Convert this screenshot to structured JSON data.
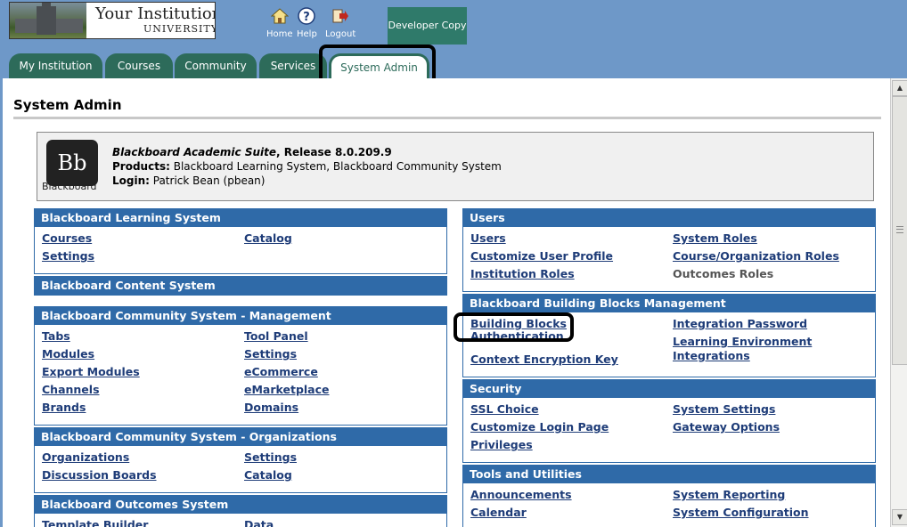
{
  "header": {
    "logo_title": "Your Institution",
    "logo_subtitle": "UNIVERSITY",
    "nav": {
      "home": "Home",
      "help": "Help",
      "logout": "Logout"
    },
    "developer_copy": "Developer Copy"
  },
  "tabs": [
    {
      "label": "My Institution"
    },
    {
      "label": "Courses"
    },
    {
      "label": "Community"
    },
    {
      "label": "Services"
    },
    {
      "label": "System Admin"
    }
  ],
  "page": {
    "title": "System Admin"
  },
  "info": {
    "logo_text": "Bb",
    "logo_label": "Blackboard",
    "suite_name": "Blackboard Academic Suite",
    "release": ", Release 8.0.209.9",
    "products_label": "Products:",
    "products_value": " Blackboard Learning System, Blackboard Community System",
    "login_label": "Login:",
    "login_value": " Patrick Bean (pbean)"
  },
  "panels": {
    "bls": {
      "title": "Blackboard Learning System",
      "links": [
        "Courses",
        "Catalog",
        "Settings"
      ]
    },
    "bcs": {
      "title": "Blackboard Content System"
    },
    "bcm": {
      "title": "Blackboard Community System - Management",
      "links": [
        "Tabs",
        "Tool Panel",
        "Modules",
        "Settings",
        "Export Modules",
        "eCommerce",
        "Channels",
        "eMarketplace",
        "Brands",
        "Domains"
      ]
    },
    "bco": {
      "title": "Blackboard Community System - Organizations",
      "links": [
        "Organizations",
        "Settings",
        "Discussion Boards",
        "Catalog"
      ]
    },
    "bos": {
      "title": "Blackboard Outcomes System",
      "links": [
        "Template Builder",
        "Data"
      ]
    },
    "users": {
      "title": "Users",
      "links": [
        "Users",
        "System Roles",
        "Customize User Profile",
        "Course/Organization Roles",
        "Institution Roles",
        "Outcomes Roles"
      ]
    },
    "bbm": {
      "title": "Blackboard Building Blocks Management",
      "links": [
        "Building Blocks",
        "Authentication",
        "Integration Password",
        "Learning Environment Integrations",
        "Context Encryption Key"
      ]
    },
    "security": {
      "title": "Security",
      "links": [
        "SSL Choice",
        "System Settings",
        "Customize Login Page",
        "Gateway Options",
        "Privileges"
      ]
    },
    "tools": {
      "title": "Tools and Utilities",
      "links": [
        "Announcements",
        "System Reporting",
        "Calendar",
        "System Configuration"
      ]
    }
  },
  "colors": {
    "panel_header": "#2f6aa8",
    "tab_green": "#2d6b5a",
    "top_bar": "#6e98c8",
    "link": "#1e3c78"
  }
}
